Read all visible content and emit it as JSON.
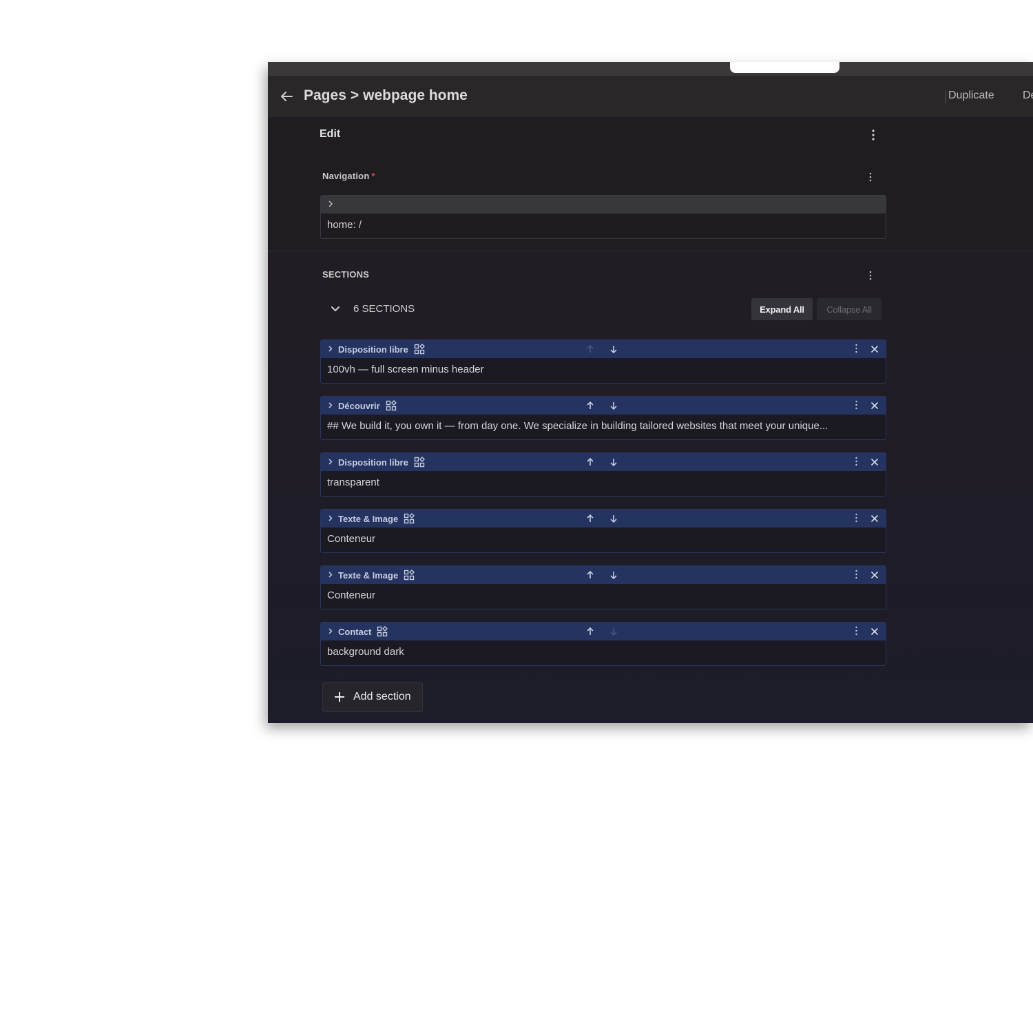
{
  "header": {
    "breadcrumb_root": "Pages",
    "breadcrumb_sep": ">",
    "breadcrumb_page": "webpage home",
    "action_duplicate": "Duplicate",
    "action_partial": "De"
  },
  "edit": {
    "title": "Edit"
  },
  "navigation": {
    "label": "Navigation",
    "required_mark": "*",
    "value": "home: /"
  },
  "sections": {
    "label": "SECTIONS",
    "count_label": "6 SECTIONS",
    "expand_all": "Expand All",
    "collapse_all": "Collapse All",
    "add_section": "Add section",
    "items": [
      {
        "title": "Disposition libre",
        "summary": "100vh — full screen minus header",
        "up_enabled": false,
        "down_enabled": true
      },
      {
        "title": "Découvrir",
        "summary": "## We build it, you own it — from day one. We specialize in building tailored websites that meet your unique...",
        "up_enabled": true,
        "down_enabled": true
      },
      {
        "title": "Disposition libre",
        "summary": "transparent",
        "up_enabled": true,
        "down_enabled": true
      },
      {
        "title": "Texte & Image",
        "summary": "Conteneur",
        "up_enabled": true,
        "down_enabled": true
      },
      {
        "title": "Texte & Image",
        "summary": "Conteneur",
        "up_enabled": true,
        "down_enabled": true
      },
      {
        "title": "Contact",
        "summary": "background dark",
        "up_enabled": true,
        "down_enabled": false
      }
    ]
  },
  "colors": {
    "section_bar": "#24335f",
    "required": "#d64c4c"
  }
}
